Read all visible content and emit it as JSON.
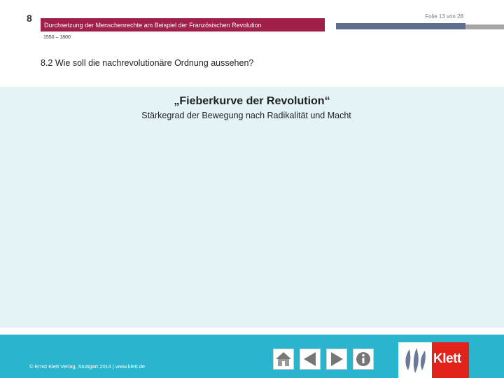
{
  "header": {
    "chapter_number": "8",
    "slide_counter": "Folie 13 von 28",
    "title": "Durchsetzung der Menschenrechte am Beispiel der Französischen Revolution",
    "period": "1550 – 1800"
  },
  "section": {
    "title": "8.2  Wie soll die nachrevolutionäre Ordnung aussehen?"
  },
  "content": {
    "heading": "„Fieberkurve der Revolution“",
    "subheading": "Stärkegrad der Bewegung nach Radikalität und Macht"
  },
  "footer": {
    "copyright": "© Ernst Klett Verlag, Stuttgart 2014 | www.klett.de",
    "logo_text": "Klett"
  },
  "colors": {
    "title_bar": "#a0204a",
    "accent_bar": "#5d6f8d",
    "content_bg": "#e4f3f5",
    "footer_bg": "#2ab5cf",
    "logo_red": "#e2231a"
  },
  "icons": {
    "home": "home-icon",
    "prev": "arrow-left-icon",
    "next": "arrow-right-icon",
    "info": "info-icon",
    "logo": "klett-logo-icon"
  }
}
